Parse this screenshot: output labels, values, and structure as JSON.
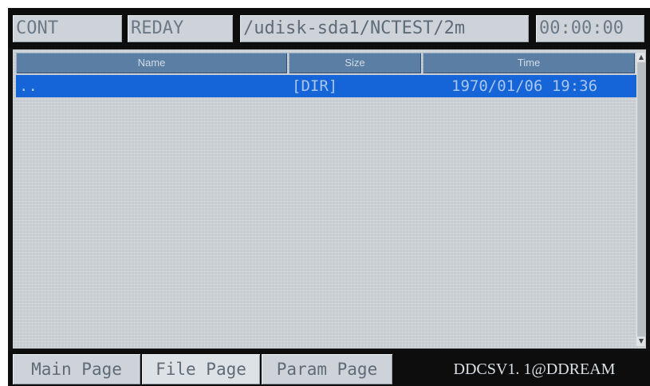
{
  "status_bar": {
    "mode": "CONT",
    "state": "REDAY",
    "path": "/udisk-sda1/NCTEST/2m",
    "timer": "00:00:00"
  },
  "file_table": {
    "columns": [
      "Name",
      "Size",
      "Time"
    ],
    "rows": [
      {
        "name": "..",
        "size": "[DIR]",
        "time": "1970/01/06 19:36",
        "selected": true
      }
    ]
  },
  "tabs": [
    {
      "label": "Main Page"
    },
    {
      "label": "File Page",
      "active": true
    },
    {
      "label": "Param Page"
    }
  ],
  "brand": "DDCSV1. 1@DDREAM",
  "colors": {
    "selection": "#1565d8",
    "header": "#5b7ea5",
    "panel": "#c7ccd1"
  }
}
